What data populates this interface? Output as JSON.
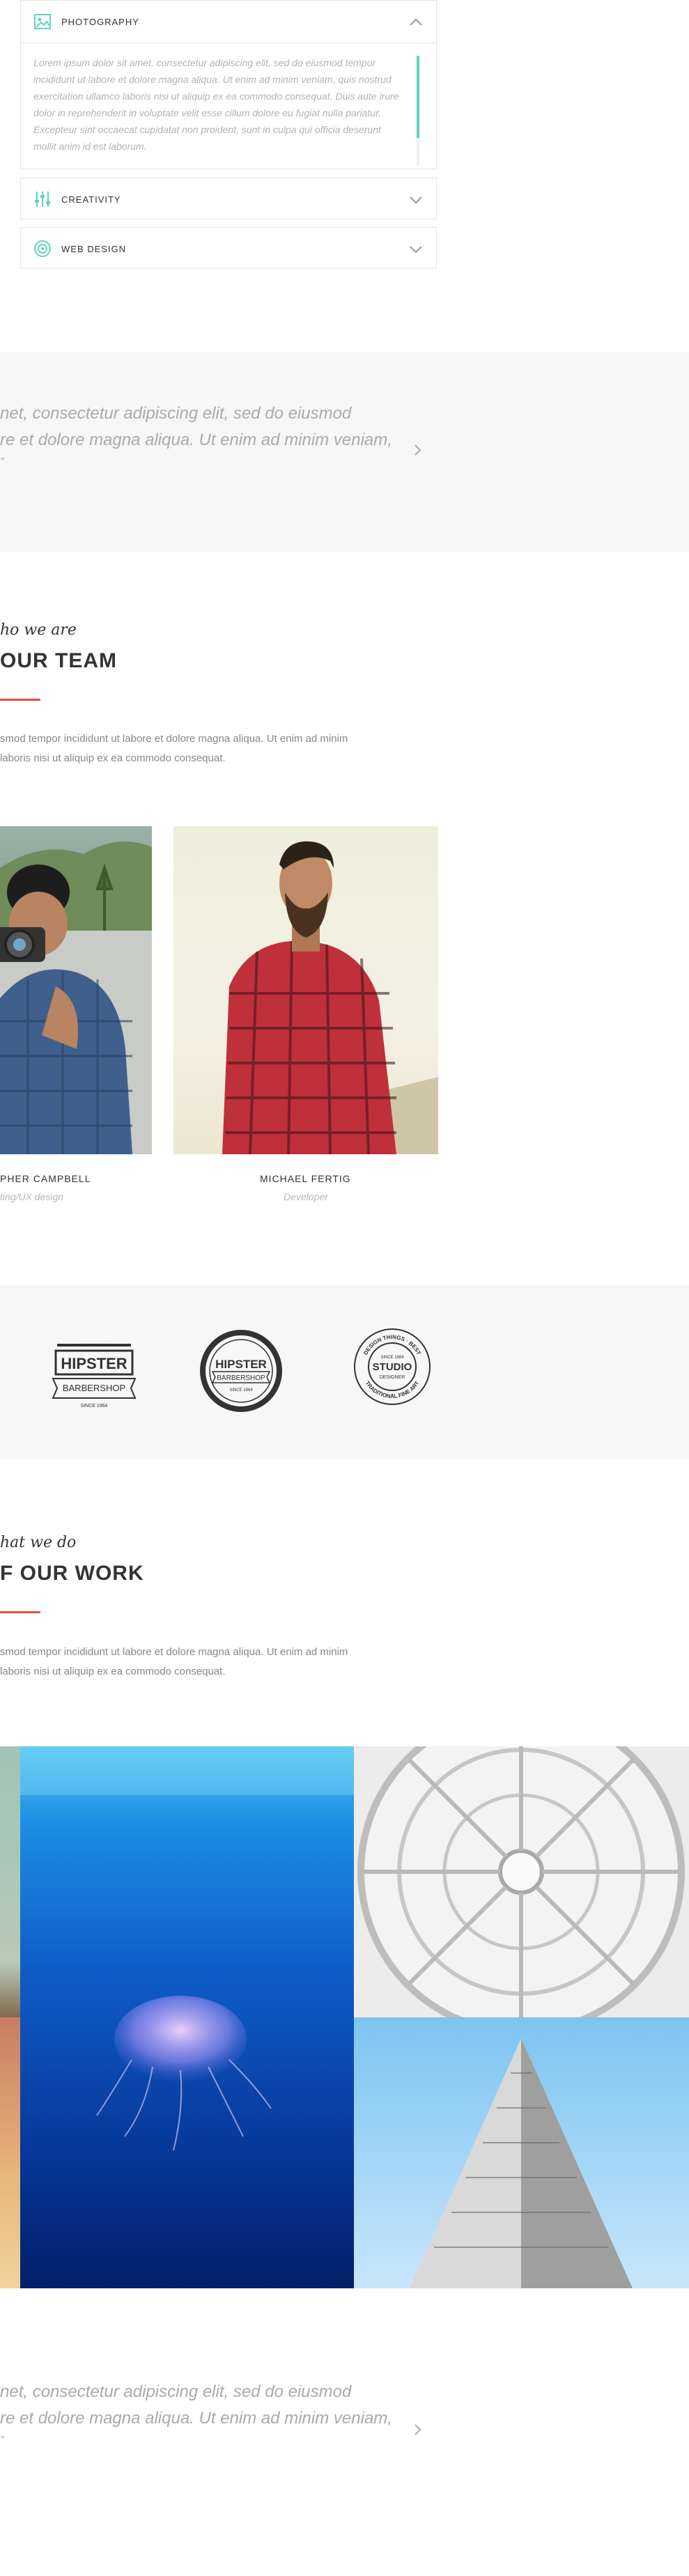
{
  "accordion": {
    "items": [
      {
        "title": "PHOTOGRAPHY",
        "icon": "image-icon",
        "expanded": true,
        "body": [
          "Lorem ipsum dolor sit amet, consectetur adipiscing elit, sed do eiusmod tempor",
          "incididunt ut labore et dolore magna aliqua. Ut enim ad minim veniam, quis nostrud",
          "exercitation ullamco laboris nisi ut aliquip ex ea commodo consequat. Duis aute irure",
          "dolor in reprehenderit in voluptate velit esse cillum dolore eu fugiat nulla pariatur.",
          "Excepteur sint occaecat cupidatat non proident, sunt in culpa qui officia deserunt",
          "mollit anim id est laborum."
        ]
      },
      {
        "title": "CREATIVITY",
        "icon": "sliders-icon",
        "expanded": false
      },
      {
        "title": "WEB DESIGN",
        "icon": "target-icon",
        "expanded": false
      }
    ],
    "accent_color": "#62d3c1"
  },
  "quote1": {
    "lines": [
      "net, consectetur adipiscing elit, sed do eiusmod",
      "re et dolore magna aliqua. Ut enim ad minim veniam,",
      "”"
    ]
  },
  "team": {
    "script": "ho we are",
    "heading": "OUR TEAM",
    "lead": [
      "smod tempor incididunt ut labore et dolore magna aliqua. Ut enim ad minim",
      "laboris nisi ut aliquip ex ea commodo consequat."
    ],
    "members": [
      {
        "name": "PHER CAMPBELL",
        "role": "ting/UX design"
      },
      {
        "name": "MICHAEL FERTIG",
        "role": "Developer"
      }
    ]
  },
  "logos": [
    {
      "icon": "hipster-barbershop-badge-icon",
      "lines": [
        "HIPSTER",
        "BARBERSHOP",
        "SINCE 1964"
      ]
    },
    {
      "icon": "hipster-barbershop-round-icon",
      "lines": [
        "HIPSTER",
        "BARBERSHOP",
        "SINCE 1964"
      ]
    },
    {
      "icon": "studio-designer-seal-icon",
      "lines": [
        "DESIGN THINGS · BEST",
        "SINCE 1984",
        "STUDIO",
        "DESIGNER",
        "TRADITIONAL FINE ART"
      ]
    }
  ],
  "work": {
    "script": "hat we do",
    "heading": "F OUR WORK",
    "lead": [
      "smod tempor incididunt ut labore et dolore magna aliqua. Ut enim ad minim",
      "laboris nisi ut aliquip ex ea commodo consequat."
    ]
  },
  "quote2": {
    "lines": [
      "net, consectetur adipiscing elit, sed do eiusmod",
      "re et dolore magna aliqua. Ut enim ad minim veniam,",
      "”"
    ]
  },
  "colors": {
    "accent": "#62d3c1",
    "red": "#e74c3c",
    "band": "#f7f7f7"
  }
}
